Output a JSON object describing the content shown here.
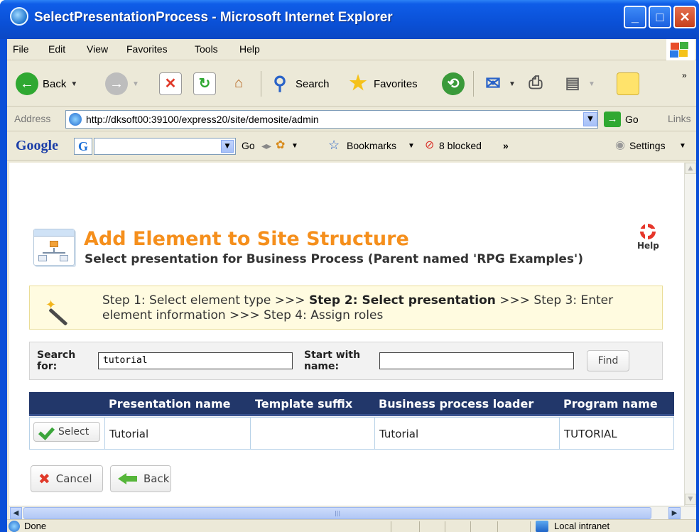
{
  "window": {
    "title": "SelectPresentationProcess - Microsoft Internet Explorer"
  },
  "menu": [
    "File",
    "Edit",
    "View",
    "Favorites",
    "Tools",
    "Help"
  ],
  "toolbar": {
    "back": "Back",
    "search": "Search",
    "favorites": "Favorites"
  },
  "address": {
    "label": "Address",
    "url": "http://dksoft00:39100/express20/site/demosite/admin",
    "go": "Go",
    "links": "Links"
  },
  "google": {
    "logo": "Google",
    "selector": "G",
    "go": "Go",
    "bookmarks": "Bookmarks",
    "blocked": "8 blocked",
    "settings": "Settings"
  },
  "page": {
    "title": "Add Element to Site Structure",
    "subtitle": "Select presentation for Business Process (Parent named 'RPG Examples')",
    "help": "Help"
  },
  "steps": {
    "step1": "Step 1: Select element type >>> ",
    "step2": "Step 2: Select presentation",
    "step3": " >>> Step 3: Enter element information >>> Step 4: Assign roles"
  },
  "search": {
    "label": "Search for:",
    "value": "tutorial",
    "start_label": "Start with name:",
    "start_value": "",
    "find": "Find"
  },
  "table": {
    "headers": [
      "Presentation name",
      "Template suffix",
      "Business process loader",
      "Program name"
    ],
    "rows": [
      {
        "select": "Select",
        "presentation": "Tutorial",
        "suffix": "",
        "loader": "Tutorial",
        "program": "TUTORIAL"
      }
    ]
  },
  "actions": {
    "cancel": "Cancel",
    "back": "Back"
  },
  "status": {
    "text": "Done",
    "zone": "Local intranet"
  },
  "colors": {
    "title_orange": "#f58f1c",
    "header_navy": "#22376a",
    "xp_blue": "#0a4fd8"
  }
}
